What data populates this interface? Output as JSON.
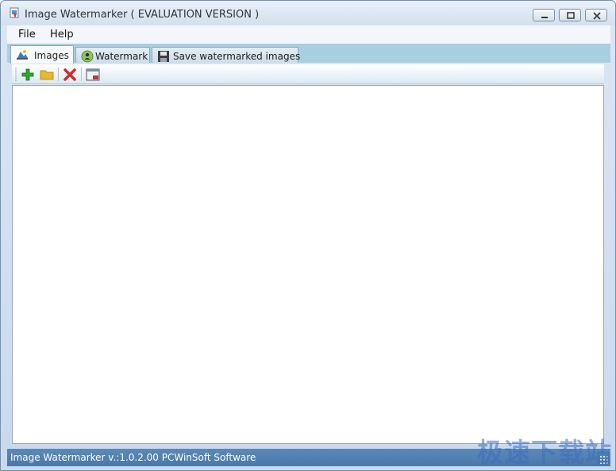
{
  "window": {
    "title": "Image Watermarker ( EVALUATION VERSION )",
    "icons": {
      "app": "app-icon",
      "minimize": "minimize-icon",
      "maximize": "restore-icon",
      "close": "close-icon"
    }
  },
  "menu": {
    "items": [
      {
        "label": "File"
      },
      {
        "label": "Help"
      }
    ]
  },
  "tabs": [
    {
      "label": "Images",
      "icon": "images-icon",
      "active": true
    },
    {
      "label": "Watermark",
      "icon": "watermark-icon",
      "active": false
    },
    {
      "label": "Save watermarked images",
      "icon": "save-icon",
      "active": false
    }
  ],
  "toolbar": {
    "buttons": [
      {
        "icon": "add-icon",
        "color": "#2fa82f"
      },
      {
        "icon": "folder-icon",
        "color": "#e9b92a"
      },
      {
        "icon": "delete-icon",
        "color": "#d42a2a"
      },
      {
        "icon": "preview-icon",
        "color": "#c23a3a"
      }
    ]
  },
  "status": {
    "text": "Image Watermarker v.:1.0.2.00 PCWinSoft Software"
  },
  "overlay": {
    "watermark_text": "极速下载站"
  }
}
